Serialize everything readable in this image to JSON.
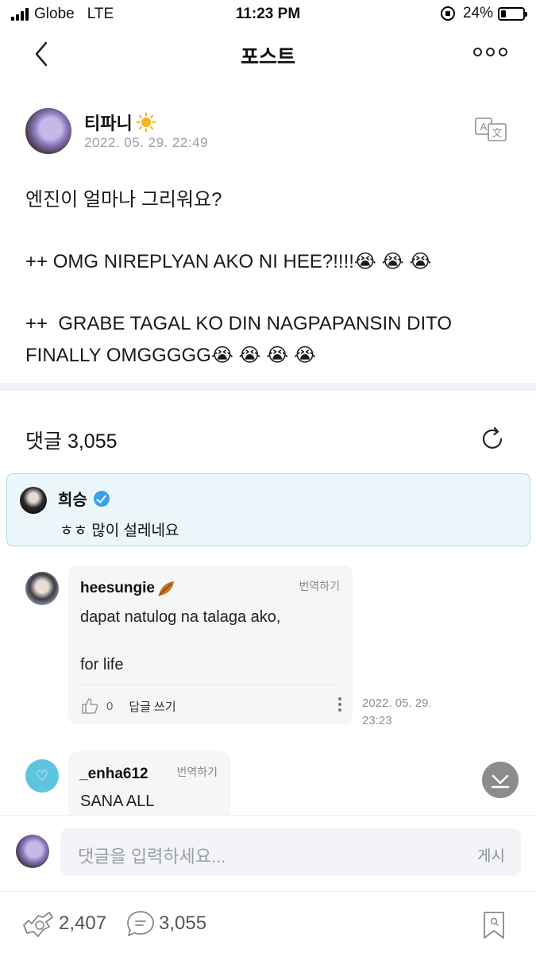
{
  "status_bar": {
    "carrier": "Globe",
    "network": "LTE",
    "time": "11:23 PM",
    "battery": "24%",
    "battery_level": 0.24
  },
  "header": {
    "title": "포스트",
    "back_icon": "chevron-left-icon",
    "more_icon": "more-horizontal-icon"
  },
  "post": {
    "author": "티파니",
    "author_badge_icon": "sun-icon",
    "date": "2022. 05. 29. 22:49",
    "translate_icon": "translate-icon",
    "lines": [
      "엔진이 얼마나 그리워요?",
      "++ OMG NIREPLYAN AKO NI HEE?!!!!😭 😭 😭",
      "++  GRABE TAGAL KO DIN NAGPAPANSIN DITO",
      "FINALLY OMGGGGG😭 😭 😭 😭"
    ]
  },
  "comments_section": {
    "label": "댓글 3,055",
    "refresh_icon": "refresh-icon"
  },
  "artist_comment": {
    "name": "희승",
    "text": "ㅎㅎ 많이 설레네요"
  },
  "comments": [
    {
      "user": "heesungie",
      "translate_label": "번역하기",
      "line1": "dapat natulog na talaga ako,",
      "line2": "for life",
      "likes": "0",
      "reply_label": "답글 쓰기",
      "date_line1": "2022. 05. 29.",
      "date_line2": "23:23"
    },
    {
      "user": "_enha612",
      "translate_label": "번역하기",
      "text": "SANA ALL"
    }
  ],
  "input": {
    "placeholder": "댓글을 입력하세요...",
    "post_label": "게시"
  },
  "footer": {
    "likes": "2,407",
    "comments": "3,055"
  },
  "colors": {
    "artist_bg": "#ebf7fb",
    "artist_border": "#a9dbe7",
    "verified": "#3aa0e8",
    "muted": "#9aa0a6"
  }
}
